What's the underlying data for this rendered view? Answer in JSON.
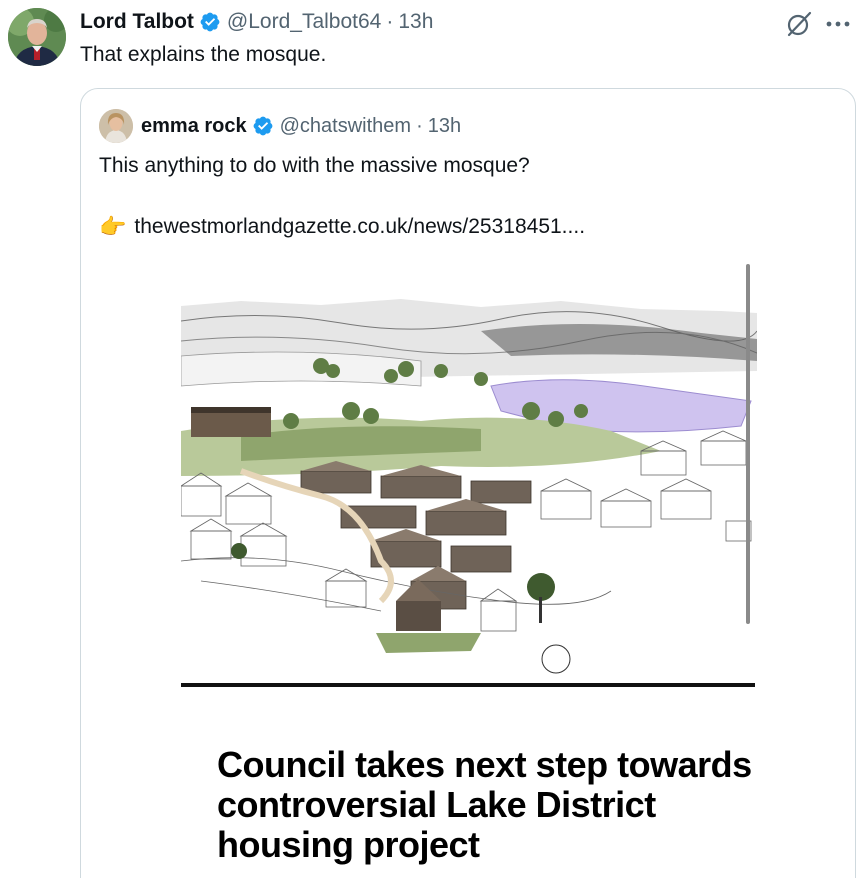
{
  "tweet": {
    "author_name": "Lord Talbot",
    "handle": "@Lord_Talbot64",
    "separator": "·",
    "time": "13h",
    "text": "That explains the mosque.",
    "verified_color": "#1d9bf0",
    "icons": [
      "grok-icon",
      "more-icon",
      "verified-badge-icon"
    ]
  },
  "quoted_tweet": {
    "author_name": "emma rock",
    "handle": "@chatswithem",
    "separator": "·",
    "time": "13h",
    "text": "This anything to do with the massive mosque?",
    "link_emoji": "👉",
    "link_text": "thewestmorlandgazette.co.uk/news/25318451....",
    "image": {
      "headline": "Council takes next step towards controversial Lake District housing project"
    }
  }
}
